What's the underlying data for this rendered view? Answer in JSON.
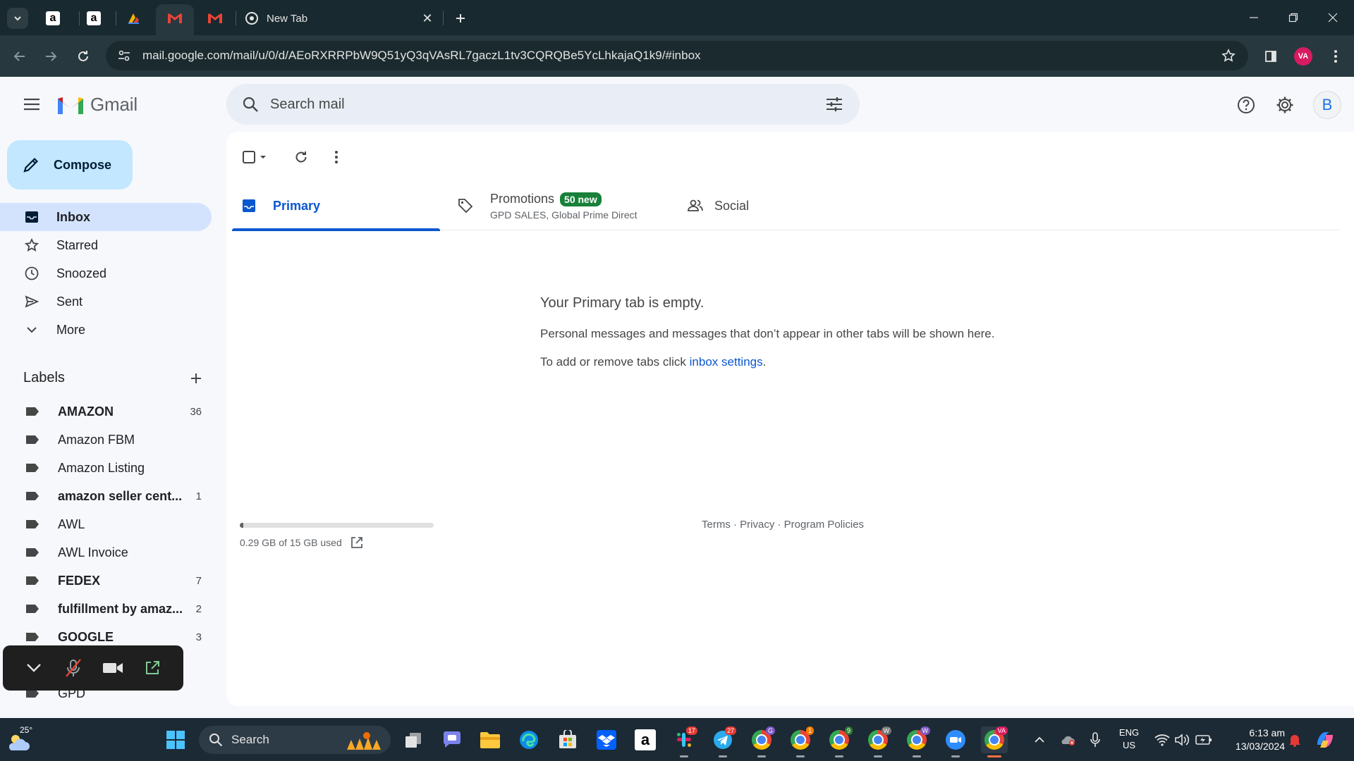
{
  "browser": {
    "tabs": [
      {
        "title": "",
        "icon": "amazon-icon"
      },
      {
        "title": "",
        "icon": "amazon-icon"
      },
      {
        "title": "",
        "icon": "app-icon"
      },
      {
        "title": "",
        "icon": "gmail-icon",
        "active": true
      },
      {
        "title": "",
        "icon": "gmail-icon"
      },
      {
        "title": "New Tab",
        "icon": "chrome-icon"
      }
    ],
    "url": "mail.google.com/mail/u/0/d/AEoRXRRPbW9Q51yQ3qVAsRL7gaczL1tv3CQRQBe5YcLhkajaQ1k9/#inbox",
    "profile_initials": "VA"
  },
  "gmail": {
    "logo_text": "Gmail",
    "search_placeholder": "Search mail",
    "avatar_letter": "B",
    "compose_label": "Compose",
    "nav": [
      {
        "label": "Inbox",
        "icon": "inbox-icon",
        "active": true
      },
      {
        "label": "Starred",
        "icon": "star-icon"
      },
      {
        "label": "Snoozed",
        "icon": "clock-icon"
      },
      {
        "label": "Sent",
        "icon": "send-icon"
      },
      {
        "label": "More",
        "icon": "chevron-down-icon"
      }
    ],
    "labels_heading": "Labels",
    "labels": [
      {
        "name": "AMAZON",
        "count": "36",
        "bold": true
      },
      {
        "name": "Amazon FBM",
        "count": "",
        "bold": false
      },
      {
        "name": "Amazon Listing",
        "count": "",
        "bold": false
      },
      {
        "name": "amazon seller cent...",
        "count": "1",
        "bold": true
      },
      {
        "name": "AWL",
        "count": "",
        "bold": false
      },
      {
        "name": "AWL Invoice",
        "count": "",
        "bold": false
      },
      {
        "name": "FEDEX",
        "count": "7",
        "bold": true
      },
      {
        "name": "fulfillment by amaz...",
        "count": "2",
        "bold": true
      },
      {
        "name": "GOOGLE",
        "count": "3",
        "bold": true
      },
      {
        "name": "GPD",
        "count": "",
        "bold": false
      }
    ],
    "tabs": {
      "primary": "Primary",
      "promotions": "Promotions",
      "promotions_badge": "50 new",
      "promotions_senders": "GPD SALES, Global Prime Direct",
      "social": "Social"
    },
    "empty": {
      "heading": "Your Primary tab is empty.",
      "body": "Personal messages and messages that don’t appear in other tabs will be shown here.",
      "settings_prefix": "To add or remove tabs click ",
      "settings_link": "inbox settings",
      "settings_suffix": "."
    },
    "storage": {
      "text": "0.29 GB of 15 GB used",
      "used_fraction": 0.019
    },
    "footer": "Terms · Privacy · Program Policies"
  },
  "taskbar": {
    "weather_temp": "25°",
    "search_label": "Search",
    "badges": {
      "slack": "17",
      "telegram": "27",
      "chrome1": "1",
      "chrome2": "9",
      "chrome3": "W",
      "chrome4": "W",
      "chrome0": "G"
    },
    "lang_line1": "ENG",
    "lang_line2": "US",
    "time": "6:13 am",
    "date": "13/03/2024"
  }
}
